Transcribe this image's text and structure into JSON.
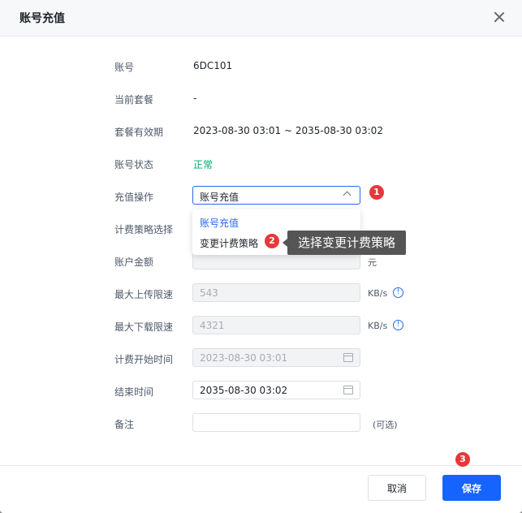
{
  "dialog": {
    "title": "账号充值"
  },
  "fields": {
    "account": {
      "label": "账号",
      "value": "6DC101"
    },
    "current_plan": {
      "label": "当前套餐",
      "value": "-"
    },
    "plan_validity": {
      "label": "套餐有效期",
      "value": "2023-08-30 03:01 ~ 2035-08-30 03:02"
    },
    "account_status": {
      "label": "账号状态",
      "value": "正常",
      "color": "#00a870"
    },
    "recharge_op": {
      "label": "充值操作",
      "value": "账号充值"
    },
    "billing_policy": {
      "label": "计费策略选择"
    },
    "balance": {
      "label": "账户金额",
      "unit": "元"
    },
    "max_upload": {
      "label": "最大上传限速",
      "value": "543",
      "unit": "KB/s"
    },
    "max_download": {
      "label": "最大下载限速",
      "value": "4321",
      "unit": "KB/s"
    },
    "billing_start": {
      "label": "计费开始时间",
      "value": "2023-08-30 03:01"
    },
    "end_time": {
      "label": "结束时间",
      "value": "2035-08-30 03:02"
    },
    "remark": {
      "label": "备注",
      "hint": "(可选)"
    }
  },
  "dropdown": {
    "options": [
      "账号充值",
      "变更计费策略"
    ],
    "selected": "账号充值"
  },
  "annotations": {
    "badges": [
      "1",
      "2",
      "3"
    ],
    "tooltip": "选择变更计费策略",
    "badge_color": "#e8373a"
  },
  "footer": {
    "cancel_label": "取消",
    "save_label": "保存"
  },
  "icons": {
    "close": "close-icon",
    "chevron": "chevron-up-icon",
    "calendar": "calendar-icon",
    "info": "info-icon"
  },
  "colors": {
    "primary": "#1664ff",
    "success": "#00a870"
  }
}
